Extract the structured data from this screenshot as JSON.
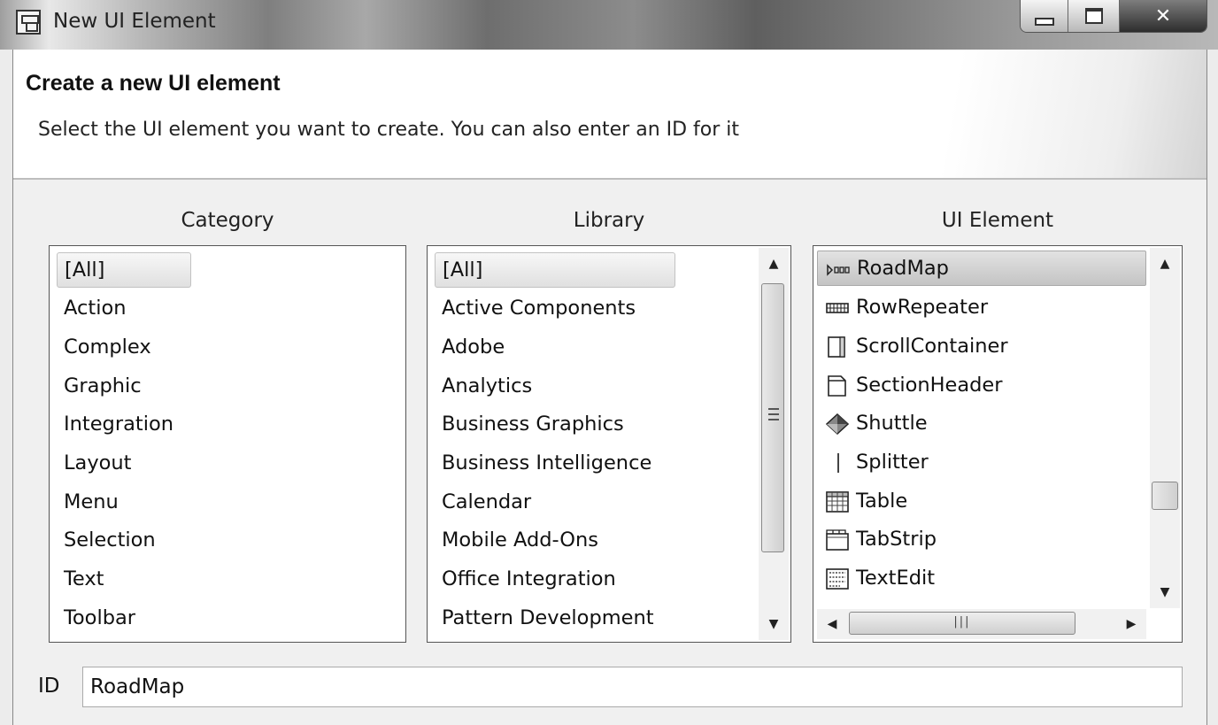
{
  "window": {
    "title": "New UI Element"
  },
  "header": {
    "title": "Create a new UI element",
    "subtitle": "Select the UI element you want to create. You can also enter an ID for it"
  },
  "category": {
    "label": "Category",
    "selected": "[All]",
    "items": [
      "[All]",
      "Action",
      "Complex",
      "Graphic",
      "Integration",
      "Layout",
      "Menu",
      "Selection",
      "Text",
      "Toolbar"
    ]
  },
  "library": {
    "label": "Library",
    "selected": "[All]",
    "items": [
      "[All]",
      "Active Components",
      "Adobe",
      "Analytics",
      "Business Graphics",
      "Business Intelligence",
      "Calendar",
      "Mobile Add-Ons",
      "Office Integration",
      "Pattern Development"
    ]
  },
  "ui_element": {
    "label": "UI Element",
    "selected": "RoadMap",
    "items": [
      {
        "label": "RoadMap",
        "icon": "roadmap-icon"
      },
      {
        "label": "RowRepeater",
        "icon": "row-repeater-icon"
      },
      {
        "label": "ScrollContainer",
        "icon": "scroll-container-icon"
      },
      {
        "label": "SectionHeader",
        "icon": "section-header-icon"
      },
      {
        "label": "Shuttle",
        "icon": "shuttle-icon"
      },
      {
        "label": "Splitter",
        "icon": "splitter-icon"
      },
      {
        "label": "Table",
        "icon": "table-icon"
      },
      {
        "label": "TabStrip",
        "icon": "tabstrip-icon"
      },
      {
        "label": "TextEdit",
        "icon": "textedit-icon"
      }
    ]
  },
  "id_field": {
    "label": "ID",
    "value": "RoadMap"
  }
}
